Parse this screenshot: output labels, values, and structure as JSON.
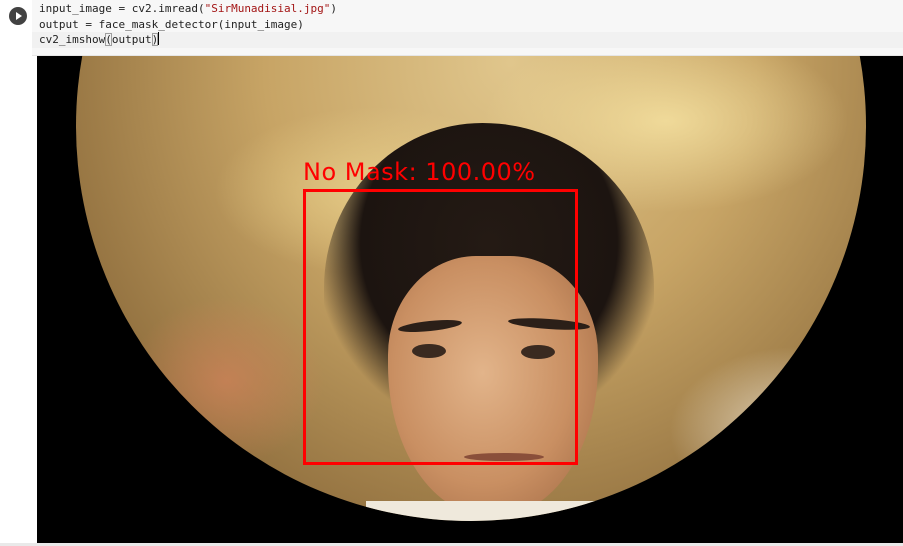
{
  "code_cell": {
    "lines": [
      {
        "pre": "input_image = cv2.imread(",
        "str": "\"SirMunadisial.jpg\"",
        "post": ")"
      },
      {
        "text": "output = face_mask_detector(input_image)"
      },
      {
        "pre": "cv2_imshow",
        "paren_open": "(",
        "mid": "output",
        "paren_close": ")"
      }
    ]
  },
  "output": {
    "detection_label": "No Mask: 100.00%",
    "box_color": "#ff0000"
  },
  "icons": {
    "run": "play-icon"
  }
}
